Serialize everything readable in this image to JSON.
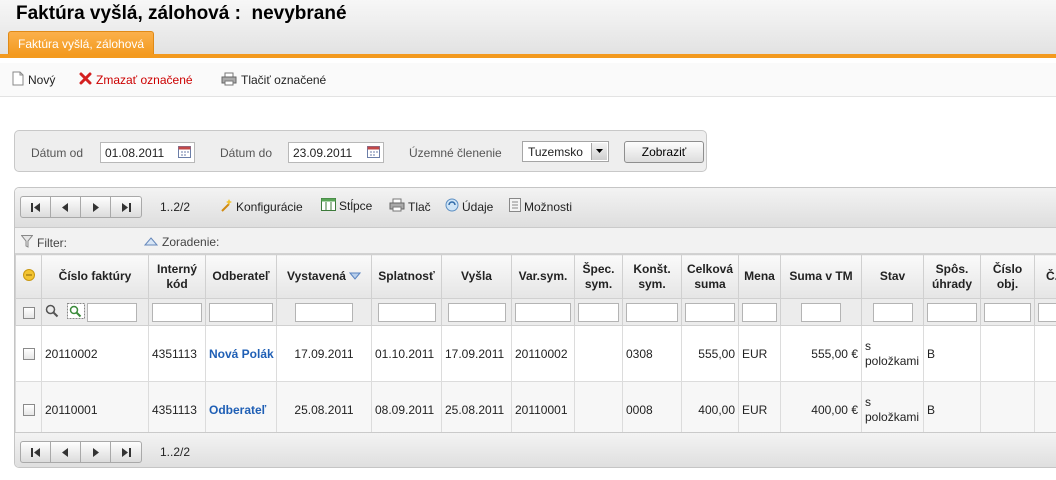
{
  "header": {
    "title": "Faktúra vyšlá, zálohová :  nevybrané",
    "tab_label": "Faktúra vyšlá, zálohová"
  },
  "toolbar": {
    "new_label": "Nový",
    "delete_label": "Zmazať označené",
    "print_label": "Tlačiť označené"
  },
  "filter": {
    "date_from_label": "Dátum od",
    "date_from_value": "01.08.2011",
    "date_to_label": "Dátum do",
    "date_to_value": "23.09.2011",
    "territory_label": "Územné členenie",
    "territory_value": "Tuzemsko",
    "show_label": "Zobraziť"
  },
  "grid": {
    "page_info": "1..2/2",
    "buttons": {
      "config": "Konfigurácie",
      "columns": "Stĺpce",
      "print": "Tlač",
      "data": "Údaje",
      "options": "Možnosti"
    },
    "filter_label": "Filter:",
    "sort_label": "Zoradenie:",
    "columns": [
      "Číslo faktúry",
      "Interný kód",
      "Odberateľ",
      "Vystavená",
      "Splatnosť",
      "Vyšla",
      "Var.sym.",
      "Špec. sym.",
      "Konšt. sym.",
      "Celková suma",
      "Mena",
      "Suma v TM",
      "Stav",
      "Spôs. úhrady",
      "Číslo obj.",
      "Č. zá"
    ],
    "rows": [
      {
        "invoice_no": "20110002",
        "internal_code": "4351113",
        "customer": "Nová Polák",
        "issued": "17.09.2011",
        "due": "01.10.2011",
        "sent": "17.09.2011",
        "var_sym": "20110002",
        "spec_sym": "",
        "const_sym": "0308",
        "total": "555,00",
        "currency": "EUR",
        "total_tm": "555,00 €",
        "status": "s položkami",
        "payment": "B",
        "order_no": ""
      },
      {
        "invoice_no": "20110001",
        "internal_code": "4351113",
        "customer": "Odberateľ",
        "issued": "25.08.2011",
        "due": "08.09.2011",
        "sent": "25.08.2011",
        "var_sym": "20110001",
        "spec_sym": "",
        "const_sym": "0008",
        "total": "400,00",
        "currency": "EUR",
        "total_tm": "400,00 €",
        "status": "s položkami",
        "payment": "B",
        "order_no": ""
      }
    ]
  },
  "colors": {
    "accent_orange": "#f39a1f",
    "link_blue": "#1f5fb5",
    "delete_red": "#cc0000"
  }
}
